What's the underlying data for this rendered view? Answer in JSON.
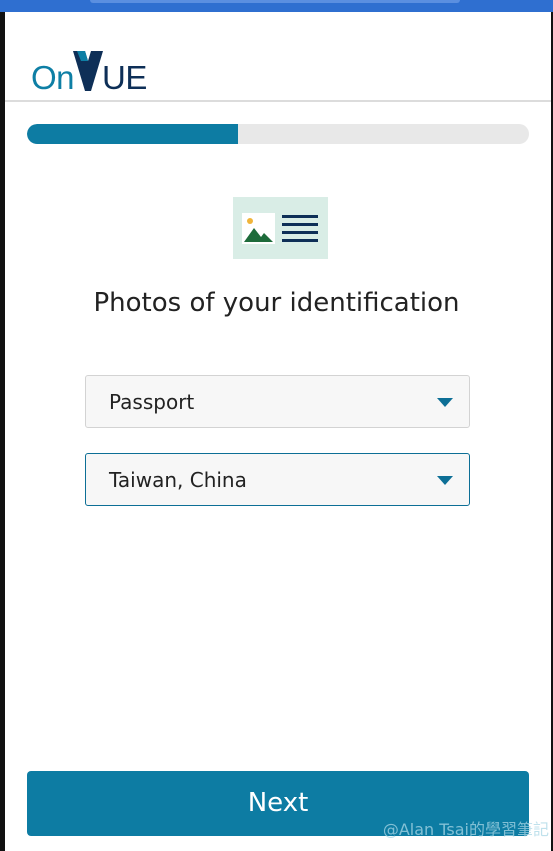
{
  "brand": {
    "logo_text": "OnVUE",
    "primary_color": "#0d7ca3",
    "dark_color": "#0e2f57"
  },
  "progress": {
    "fraction": 0.42
  },
  "main": {
    "icon": "id-card-icon",
    "title": "Photos of your identification",
    "document_select": {
      "value": "Passport",
      "caret_icon": "caret-down-icon"
    },
    "country_select": {
      "value": "Taiwan, China",
      "caret_icon": "caret-down-icon"
    }
  },
  "footer": {
    "next_label": "Next"
  },
  "watermark": "@Alan Tsai的學習筆記"
}
